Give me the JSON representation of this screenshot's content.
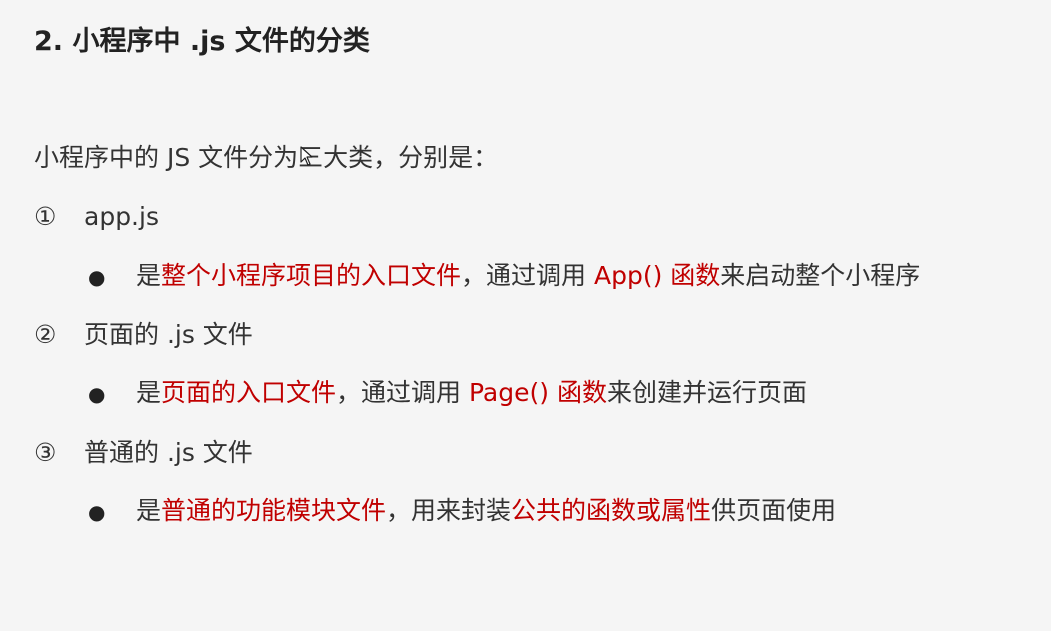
{
  "title": "2. 小程序中 .js 文件的分类",
  "intro": "小程序中的 JS 文件分为三大类，分别是：",
  "items": [
    {
      "marker": "①",
      "label": "app.js",
      "bullet": "●",
      "desc": [
        {
          "text": "是",
          "red": false
        },
        {
          "text": "整个小程序项目的入口文件",
          "red": true
        },
        {
          "text": "，通过调用 ",
          "red": false
        },
        {
          "text": "App() 函数",
          "red": true
        },
        {
          "text": "来启动整个小程序",
          "red": false
        }
      ]
    },
    {
      "marker": "②",
      "label": "页面的 .js 文件",
      "bullet": "●",
      "desc": [
        {
          "text": "是",
          "red": false
        },
        {
          "text": "页面的入口文件",
          "red": true
        },
        {
          "text": "，通过调用 ",
          "red": false
        },
        {
          "text": "Page() 函数",
          "red": true
        },
        {
          "text": "来创建并运行页面",
          "red": false
        }
      ]
    },
    {
      "marker": "③",
      "label": "普通的 .js 文件",
      "bullet": "●",
      "desc": [
        {
          "text": "是",
          "red": false
        },
        {
          "text": "普通的功能模块文件",
          "red": true
        },
        {
          "text": "，用来封装",
          "red": false
        },
        {
          "text": "公共的函数或属性",
          "red": true
        },
        {
          "text": "供页面使用",
          "red": false
        }
      ]
    }
  ],
  "colors": {
    "background": "#f5f5f5",
    "text": "#333333",
    "highlight": "#c00000"
  },
  "icons": {
    "cursor": "mouse-cursor-icon"
  }
}
